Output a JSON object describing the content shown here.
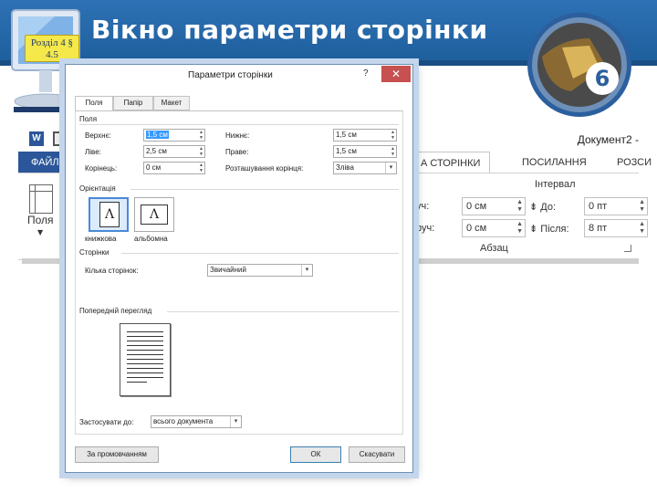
{
  "slide": {
    "title": "Вікно параметри сторінки",
    "section_badge_line1": "Розділ 4 §",
    "section_badge_line2": "4.5",
    "logo_number": "6"
  },
  "word": {
    "app_icon_letter": "W",
    "document_title": "Документ2 - ",
    "file_tab": "ФАЙЛ",
    "ribbon_tabs": [
      "А СТОРІНКИ",
      "ПОСИЛАННЯ",
      "РОЗСИ"
    ],
    "margins_label": "Поля",
    "paragraph": {
      "interval_title": "Інтервал",
      "before_label_left": "уч:",
      "before_value": "0 см",
      "after_label_left": "руч:",
      "after_value": "0 см",
      "to_label": "До:",
      "to_value": "0 пт",
      "after2_label": "Після:",
      "after2_value": "8 пт",
      "group_label": "Абзац"
    }
  },
  "dialog": {
    "title": "Параметри сторінки",
    "help": "?",
    "close": "✕",
    "tabs": [
      "Поля",
      "Папір",
      "Макет"
    ],
    "margins_group": "Поля",
    "top_label": "Верхнє:",
    "top_value": "1,5 см",
    "bottom_label": "Нижнє:",
    "bottom_value": "1,5 см",
    "left_label": "Ліве:",
    "left_value": "2,5 см",
    "right_label": "Праве:",
    "right_value": "1,5 см",
    "gutter_label": "Корінець:",
    "gutter_value": "0 см",
    "gutter_pos_label": "Розташування корінця:",
    "gutter_pos_value": "Зліва",
    "orientation_group": "Орієнтація",
    "portrait_label": "книжкова",
    "landscape_label": "альбомна",
    "orientation_glyph": "Λ",
    "pages_group": "Сторінки",
    "pages_label": "Кілька сторінок:",
    "pages_value": "Звичайний",
    "preview_group": "Попередній перегляд",
    "apply_label": "Застосувати до:",
    "apply_value": "всього документа",
    "default_button": "За промовчанням",
    "ok_button": "ОК",
    "cancel_button": "Скасувати"
  }
}
